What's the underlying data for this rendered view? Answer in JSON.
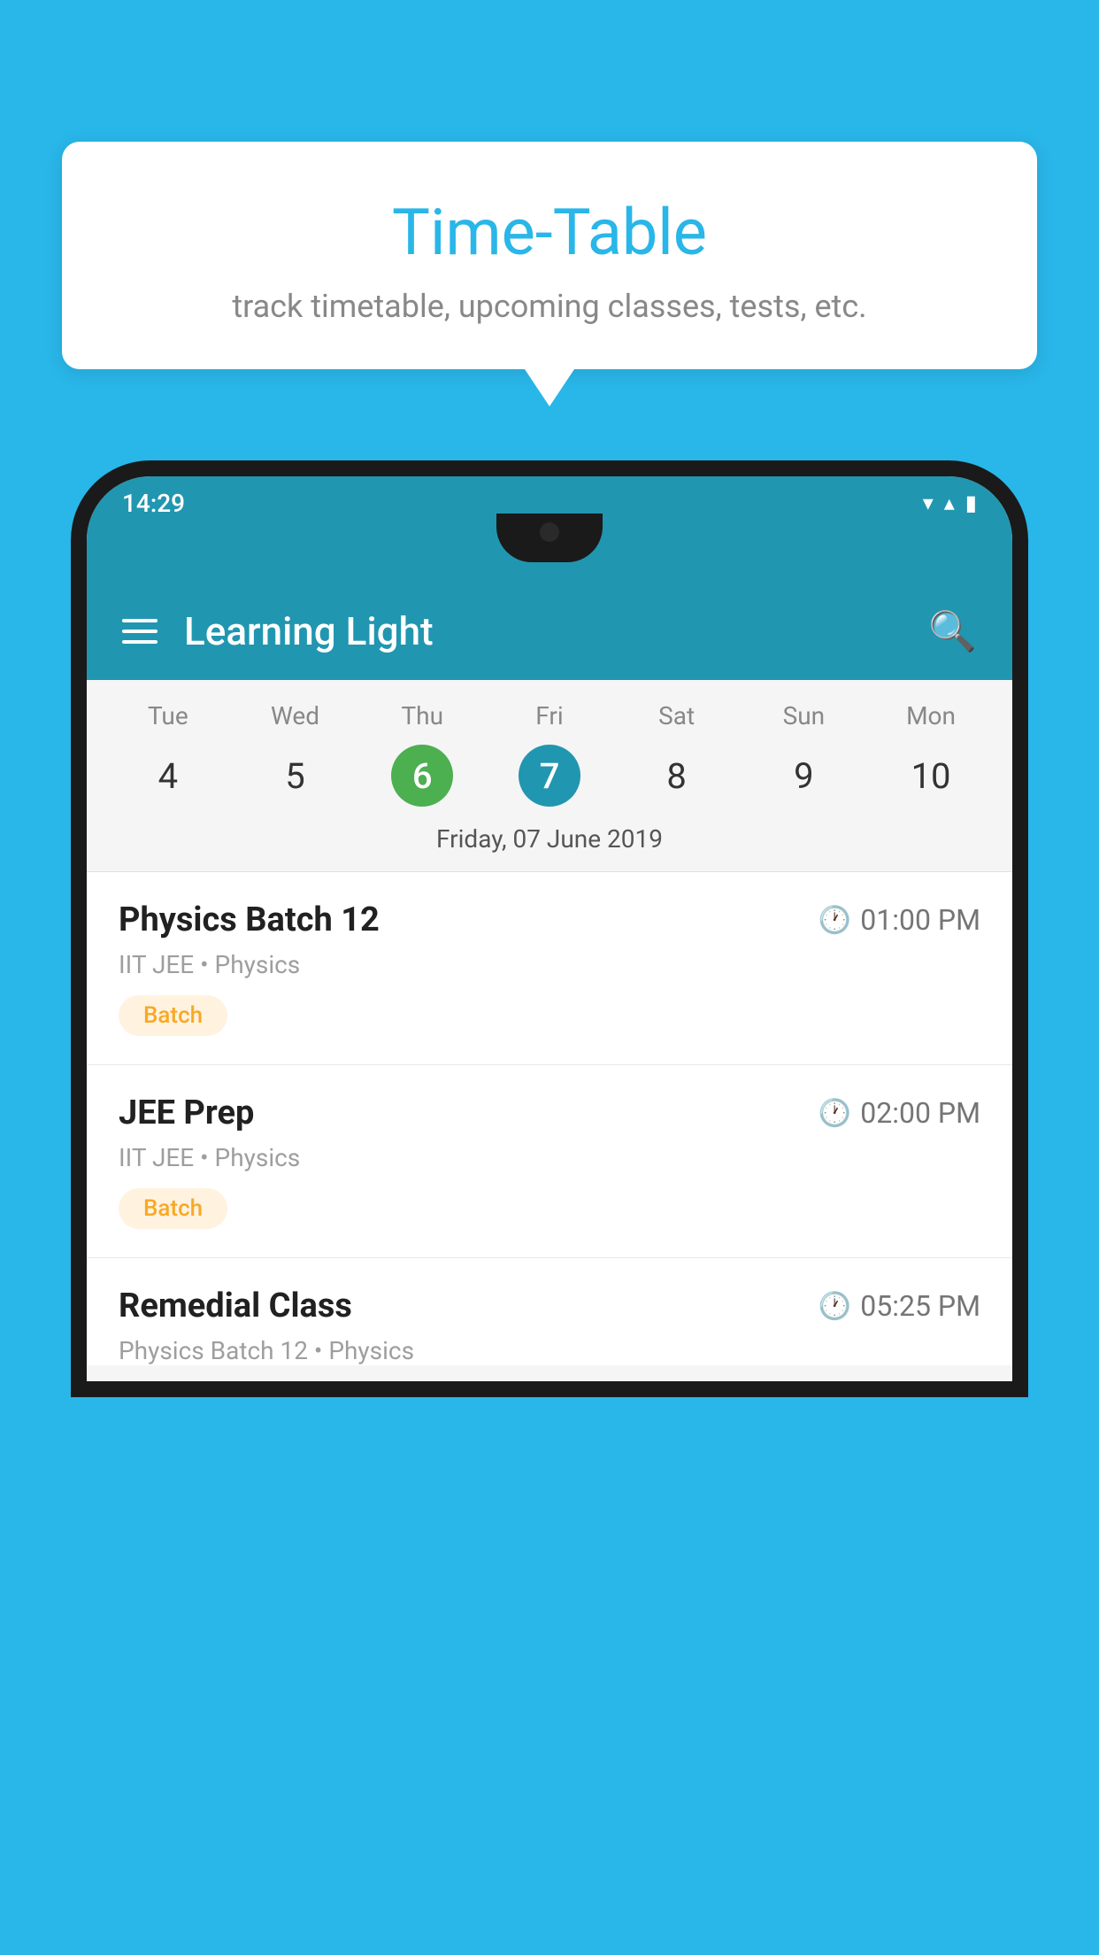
{
  "background_color": "#29b6e8",
  "bubble": {
    "title": "Time-Table",
    "subtitle": "track timetable, upcoming classes, tests, etc."
  },
  "status_bar": {
    "time": "14:29",
    "wifi_icon": "▼",
    "signal_icon": "▲",
    "battery_icon": "▮"
  },
  "app_bar": {
    "title": "Learning Light",
    "menu_icon": "menu",
    "search_icon": "search"
  },
  "calendar": {
    "days": [
      {
        "name": "Tue",
        "number": "4",
        "state": "normal"
      },
      {
        "name": "Wed",
        "number": "5",
        "state": "normal"
      },
      {
        "name": "Thu",
        "number": "6",
        "state": "today"
      },
      {
        "name": "Fri",
        "number": "7",
        "state": "selected"
      },
      {
        "name": "Sat",
        "number": "8",
        "state": "normal"
      },
      {
        "name": "Sun",
        "number": "9",
        "state": "normal"
      },
      {
        "name": "Mon",
        "number": "10",
        "state": "normal"
      }
    ],
    "selected_date_label": "Friday, 07 June 2019"
  },
  "schedule": {
    "items": [
      {
        "title": "Physics Batch 12",
        "time": "01:00 PM",
        "subtitle": "IIT JEE • Physics",
        "badge": "Batch"
      },
      {
        "title": "JEE Prep",
        "time": "02:00 PM",
        "subtitle": "IIT JEE • Physics",
        "badge": "Batch"
      },
      {
        "title": "Remedial Class",
        "time": "05:25 PM",
        "subtitle": "Physics Batch 12 • Physics",
        "badge": null
      }
    ]
  }
}
